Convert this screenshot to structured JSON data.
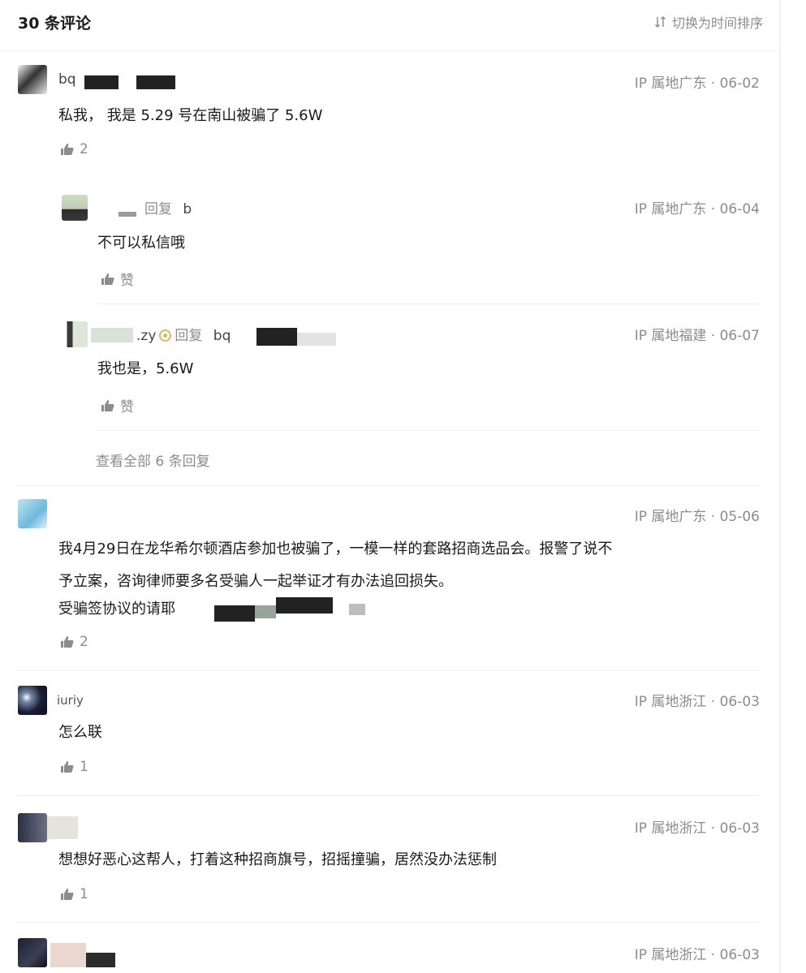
{
  "header": {
    "count_label": "30 条评论",
    "sort_label": "切换为时间排序",
    "sort_icon": "sort-arrows-icon"
  },
  "comments": [
    {
      "name": "bq",
      "meta": "IP 属地广东 · 06-02",
      "content": "私我， 我是 5.29 号在南山被骗了 5.6W",
      "likes": "2",
      "replies": [
        {
          "name_prefix": "",
          "reply_word": "回复",
          "target": "b",
          "meta": "IP 属地广东 · 06-04",
          "content": "不可以私信哦",
          "likes": "赞"
        },
        {
          "name_prefix": ".zy",
          "reply_word": "回复",
          "target": "bq",
          "meta": "IP 属地福建 · 06-07",
          "content": "我也是，5.6W",
          "likes": "赞"
        }
      ],
      "more_replies": "查看全部 6 条回复"
    },
    {
      "name": "",
      "meta": "IP 属地广东 · 05-06",
      "content_lines": [
        "我4月29日在龙华希尔顿酒店参加也被骗了，一模一样的套路招商选品会。报警了说不",
        "予立案，咨询律师要多名受骗人一起举证才有办法追回损失。",
        "受骗签协议的请耶"
      ],
      "likes": "2"
    },
    {
      "name": "iuriy",
      "meta": "IP 属地浙江 · 06-03",
      "content": "怎么联",
      "likes": "1"
    },
    {
      "name": "",
      "meta": "IP 属地浙江 · 06-03",
      "content": "想想好恶心这帮人，打着这种招商旗号，招摇撞骗，居然没办法惩制",
      "likes": "1"
    },
    {
      "name": "",
      "meta": "IP 属地浙江 · 06-03"
    }
  ],
  "colors": {
    "text": "#1a1a1a",
    "muted": "#8c8c8c",
    "divider": "#efefef",
    "badge": "#e0b563"
  }
}
